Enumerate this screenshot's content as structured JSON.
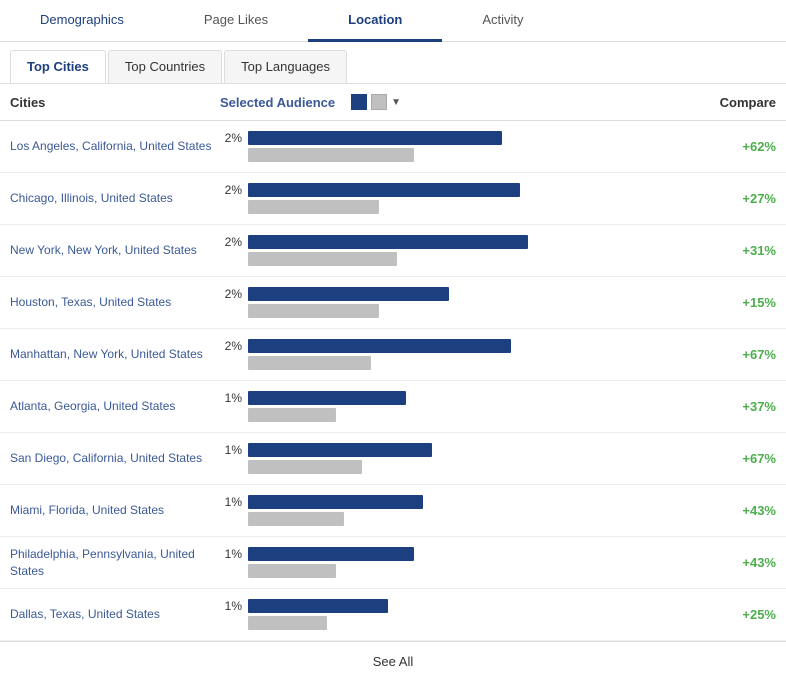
{
  "topNav": {
    "tabs": [
      {
        "id": "demographics",
        "label": "Demographics",
        "active": false
      },
      {
        "id": "page-likes",
        "label": "Page Likes",
        "active": false
      },
      {
        "id": "location",
        "label": "Location",
        "active": true
      },
      {
        "id": "activity",
        "label": "Activity",
        "active": false
      }
    ]
  },
  "subNav": {
    "tabs": [
      {
        "id": "top-cities",
        "label": "Top Cities",
        "active": true
      },
      {
        "id": "top-countries",
        "label": "Top Countries",
        "active": false
      },
      {
        "id": "top-languages",
        "label": "Top Languages",
        "active": false
      }
    ]
  },
  "tableHeader": {
    "cityCol": "Cities",
    "audienceCol": "Selected Audience",
    "compareCol": "Compare"
  },
  "rows": [
    {
      "city": "Los Angeles, California, United States",
      "pct": "2%",
      "blueWidth": 58,
      "grayWidth": 38,
      "compare": "+62%"
    },
    {
      "city": "Chicago, Illinois, United States",
      "pct": "2%",
      "blueWidth": 62,
      "grayWidth": 30,
      "compare": "+27%"
    },
    {
      "city": "New York, New York, United States",
      "pct": "2%",
      "blueWidth": 64,
      "grayWidth": 34,
      "compare": "+31%"
    },
    {
      "city": "Houston, Texas, United States",
      "pct": "2%",
      "blueWidth": 46,
      "grayWidth": 30,
      "compare": "+15%"
    },
    {
      "city": "Manhattan, New York, United States",
      "pct": "2%",
      "blueWidth": 60,
      "grayWidth": 28,
      "compare": "+67%"
    },
    {
      "city": "Atlanta, Georgia, United States",
      "pct": "1%",
      "blueWidth": 36,
      "grayWidth": 20,
      "compare": "+37%"
    },
    {
      "city": "San Diego, California, United States",
      "pct": "1%",
      "blueWidth": 42,
      "grayWidth": 26,
      "compare": "+67%"
    },
    {
      "city": "Miami, Florida, United States",
      "pct": "1%",
      "blueWidth": 40,
      "grayWidth": 22,
      "compare": "+43%"
    },
    {
      "city": "Philadelphia, Pennsylvania, United States",
      "pct": "1%",
      "blueWidth": 38,
      "grayWidth": 20,
      "compare": "+43%"
    },
    {
      "city": "Dallas, Texas, United States",
      "pct": "1%",
      "blueWidth": 32,
      "grayWidth": 18,
      "compare": "+25%"
    }
  ],
  "seeAllLabel": "See All",
  "maxBarWidth": 380
}
